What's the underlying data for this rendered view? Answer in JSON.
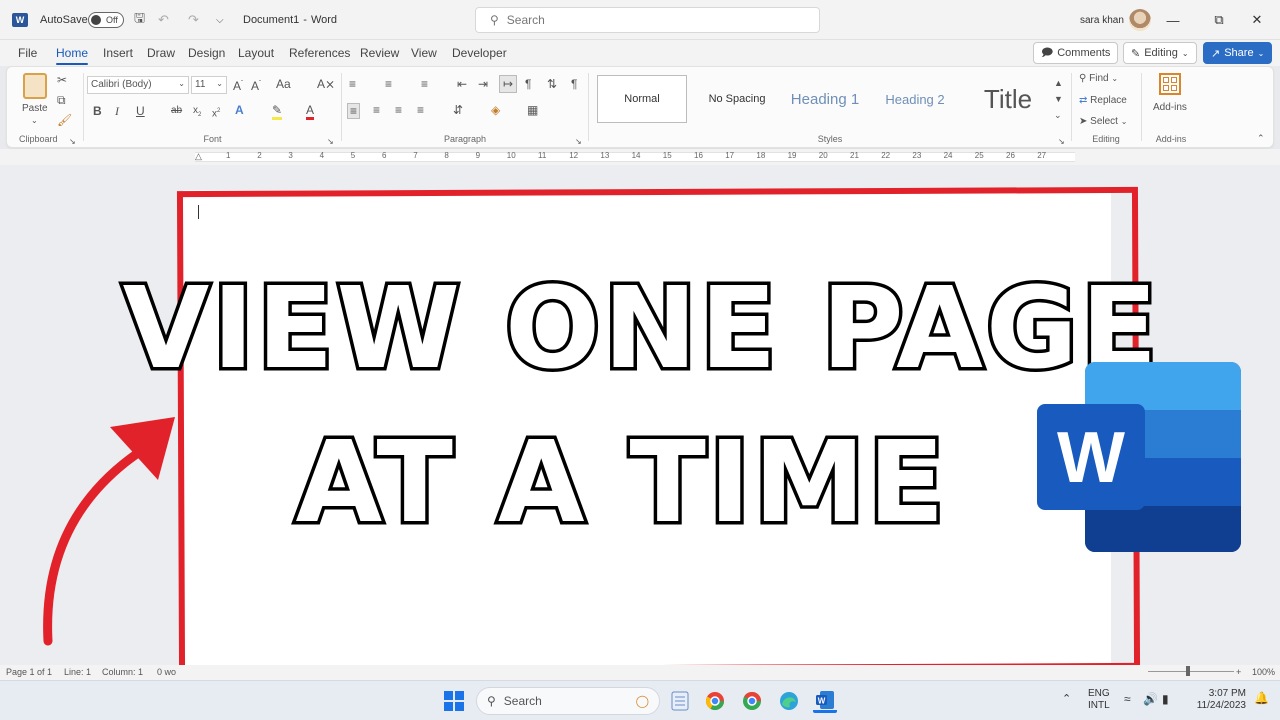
{
  "titlebar": {
    "autosave_label": "AutoSave",
    "autosave_state": "Off",
    "doc_title": "Document1",
    "app_name": "Word",
    "title_sep": "-",
    "search_placeholder": "Search",
    "user_name": "sara khan"
  },
  "tabs": [
    "File",
    "Home",
    "Insert",
    "Draw",
    "Design",
    "Layout",
    "References",
    "Review",
    "View",
    "Developer"
  ],
  "tab_actions": {
    "comments": "Comments",
    "editing": "Editing",
    "share": "Share"
  },
  "ribbon": {
    "clipboard": {
      "paste": "Paste",
      "label": "Clipboard"
    },
    "font": {
      "family": "Calibri (Body)",
      "size": "11",
      "label": "Font"
    },
    "paragraph": {
      "label": "Paragraph"
    },
    "styles": {
      "items": [
        "Normal",
        "No Spacing",
        "Heading 1",
        "Heading 2",
        "Title"
      ],
      "label": "Styles"
    },
    "editing": {
      "find": "Find",
      "replace": "Replace",
      "select": "Select",
      "label": "Editing"
    },
    "addins": {
      "button": "Add-ins",
      "label": "Add-ins"
    }
  },
  "ruler_numbers": [
    "1",
    "2",
    "3",
    "4",
    "5",
    "6",
    "7",
    "8",
    "9",
    "10",
    "11",
    "12",
    "13",
    "14",
    "15",
    "16",
    "17",
    "18",
    "19",
    "20",
    "21",
    "22",
    "23",
    "24",
    "25",
    "26",
    "27"
  ],
  "document": {
    "line1": "VIEW ONE PAGE",
    "line2": "AT A TIME"
  },
  "logo": {
    "letter": "W"
  },
  "statusbar": {
    "page": "Page 1 of 1",
    "line": "Line: 1",
    "column": "Column: 1",
    "words": "0 wo",
    "zoom": "100%"
  },
  "taskbar": {
    "search": "Search",
    "lang1": "ENG",
    "lang2": "INTL",
    "time": "3:07 PM",
    "date": "11/24/2023"
  },
  "colors": {
    "accent": "#185abd",
    "red_frame": "#e2222a",
    "word_blue": "#2b579a"
  }
}
